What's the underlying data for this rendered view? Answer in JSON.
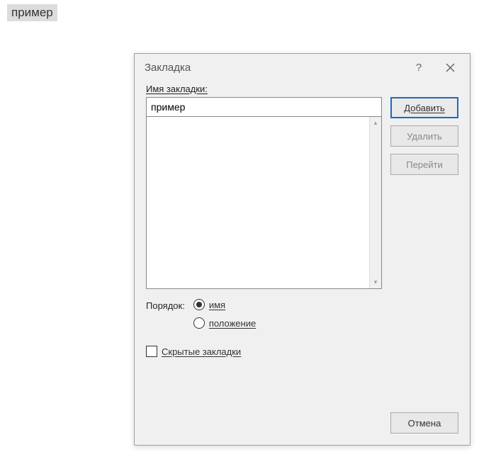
{
  "document": {
    "selected_text": "пример"
  },
  "dialog": {
    "title": "Закладка",
    "help_symbol": "?",
    "name_label": "Имя закладки:",
    "name_value": "пример",
    "buttons": {
      "add": "Добавить",
      "delete": "Удалить",
      "goto": "Перейти",
      "cancel": "Отмена"
    },
    "sort": {
      "label": "Порядок:",
      "by_name": "имя",
      "by_position": "положение",
      "selected": "name"
    },
    "hidden_label": "Скрытые закладки"
  }
}
